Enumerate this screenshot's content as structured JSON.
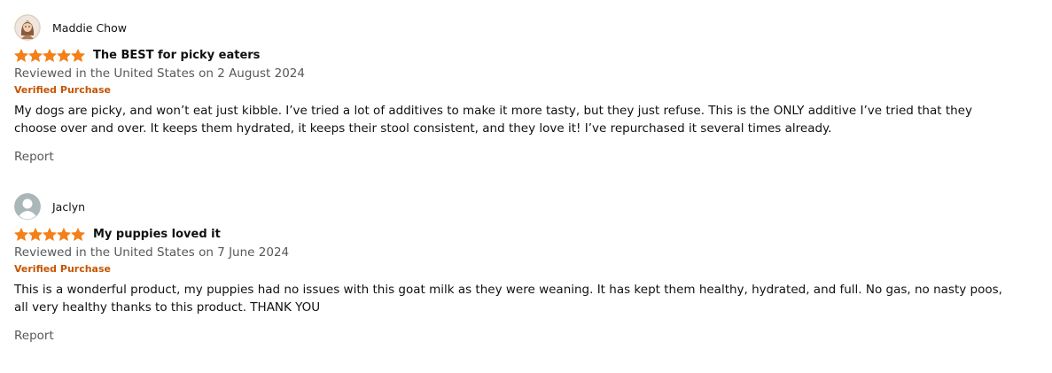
{
  "reviews": [
    {
      "reviewer": "Maddie Chow",
      "avatar_icon": "profile-photo-avatar",
      "rating": 5,
      "rating_max": 5,
      "title": "The BEST for picky eaters",
      "date": "Reviewed in the United States on 2 August 2024",
      "verified": "Verified Purchase",
      "body": "My dogs are picky, and won’t eat just kibble. I’ve tried a lot of additives to make it more tasty, but they just refuse. This is the ONLY additive I’ve tried that they choose over and over. It keeps them hydrated, it keeps their stool consistent, and they love it! I’ve repurchased it several times already.",
      "report": "Report"
    },
    {
      "reviewer": "Jaclyn",
      "avatar_icon": "default-user-avatar",
      "rating": 5,
      "rating_max": 5,
      "title": "My puppies loved it",
      "date": "Reviewed in the United States on 7 June 2024",
      "verified": "Verified Purchase",
      "body": "This is a wonderful product, my puppies had no issues with this goat milk as they were weaning. It has kept them healthy, hydrated, and full. No gas, no nasty poos, all very healthy thanks to this product. THANK YOU",
      "report": "Report"
    }
  ],
  "colors": {
    "star": "#f4801a",
    "verified": "#c45500",
    "muted": "#565959",
    "text": "#0f1111"
  }
}
